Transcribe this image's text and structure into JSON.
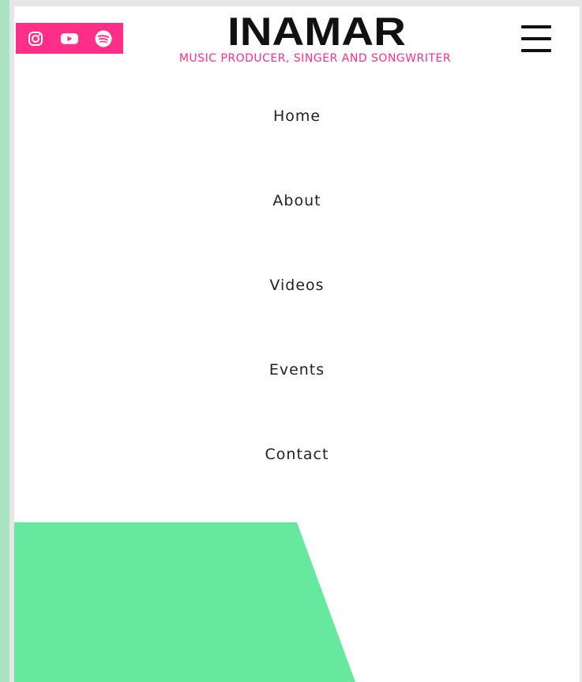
{
  "brand": {
    "logo_text": "INAMAR",
    "tagline": "MUSIC PRODUCER, SINGER AND SONGWRITER",
    "accent_color": "#ff2e88",
    "hero_color": "#66e89e"
  },
  "social": [
    {
      "name": "instagram-icon"
    },
    {
      "name": "youtube-icon"
    },
    {
      "name": "spotify-icon"
    }
  ],
  "menu_icon": "hamburger-menu-icon",
  "nav": {
    "items": [
      {
        "label": "Home"
      },
      {
        "label": "About"
      },
      {
        "label": "Videos"
      },
      {
        "label": "Events"
      },
      {
        "label": "Contact"
      }
    ]
  }
}
